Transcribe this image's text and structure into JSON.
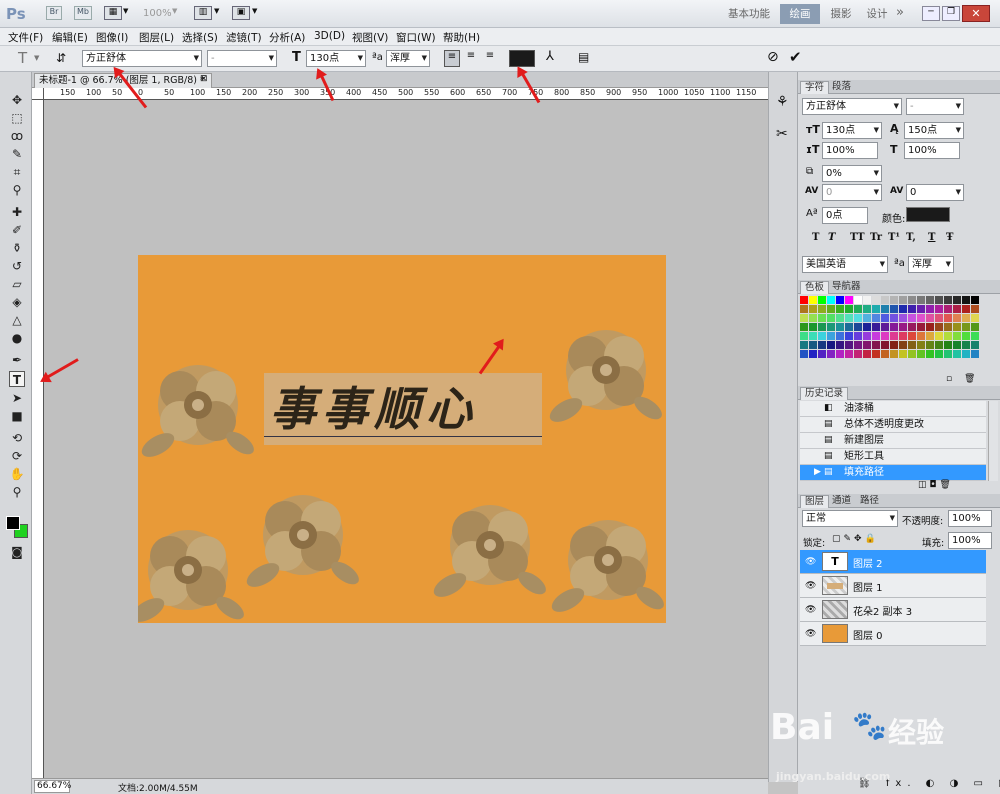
{
  "app": {
    "logo": "Ps",
    "zoom": "100%"
  },
  "workspace": {
    "basic": "基本功能",
    "paint": "绘画",
    "photo": "摄影",
    "design": "设计",
    "more": "»"
  },
  "menu": [
    "文件(F)",
    "编辑(E)",
    "图像(I)",
    "图层(L)",
    "选择(S)",
    "滤镜(T)",
    "分析(A)",
    "3D(D)",
    "视图(V)",
    "窗口(W)",
    "帮助(H)"
  ],
  "options": {
    "font_family": "方正舒体",
    "font_style": "-",
    "font_size": "130点",
    "antialias": "浑厚",
    "color_hex": "#1a1a1a"
  },
  "doc": {
    "tab_title": "未标题-1 @ 66.7% (图层 1, RGB/8) *",
    "canvas_text": "事事顺心",
    "canvas_bg": "#e89a38",
    "status_zoom": "66.67%",
    "status_doc": "文档:2.00M/4.55M"
  },
  "ruler": {
    "h_ticks": [
      "150",
      "100",
      "50",
      "0",
      "50",
      "100",
      "150",
      "200",
      "250",
      "300",
      "350",
      "400",
      "450",
      "500",
      "550",
      "600",
      "650",
      "700",
      "750",
      "800",
      "850",
      "900",
      "950",
      "1000",
      "1050",
      "1100",
      "1150"
    ]
  },
  "char_panel": {
    "tabs": [
      "字符",
      "段落"
    ],
    "font_family": "方正舒体",
    "font_style": "-",
    "size": "130点",
    "leading": "150点",
    "vscale": "100%",
    "hscale": "100%",
    "tracking_pct": "0%",
    "kerning": "0",
    "tracking": "0",
    "baseline": "0点",
    "color_label": "颜色:",
    "styles": [
      "T",
      "T",
      "TT",
      "Tr",
      "T¹",
      "T,",
      "T",
      "Ŧ"
    ],
    "language": "美国英语",
    "antialias": "浑厚"
  },
  "swatches_panel": {
    "tabs": [
      "色板",
      "导航器"
    ]
  },
  "history_panel": {
    "tab": "历史记录",
    "items": [
      "油漆桶",
      "总体不透明度更改",
      "新建图层",
      "矩形工具",
      "填充路径"
    ],
    "selected_index": 4
  },
  "layers_panel": {
    "tabs": [
      "图层",
      "通道",
      "路径"
    ],
    "blend_mode": "正常",
    "opacity_label": "不透明度:",
    "opacity": "100%",
    "lock_label": "锁定:",
    "fill_label": "填充:",
    "fill": "100%",
    "layers": [
      {
        "name": "图层 2",
        "selected": true
      },
      {
        "name": "图层 1",
        "selected": false
      },
      {
        "name": "花朵2 副本 3",
        "selected": false
      },
      {
        "name": "图层 0",
        "selected": false
      }
    ]
  },
  "watermark": {
    "brand": "Bai",
    "cn": "经验",
    "url": "jingyan.baidu.com"
  }
}
